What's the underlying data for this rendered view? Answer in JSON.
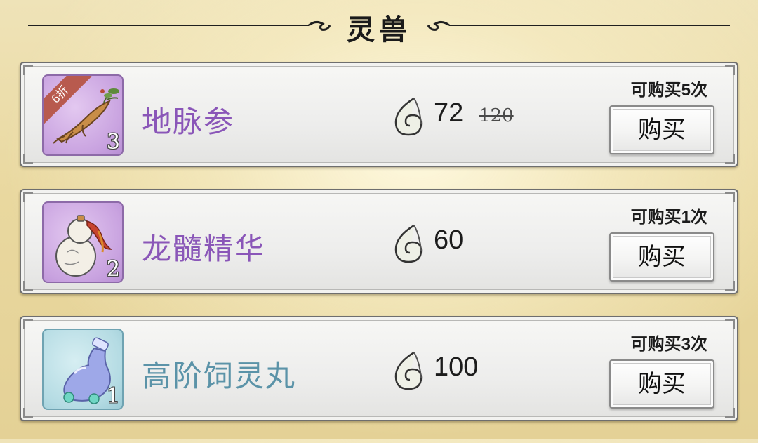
{
  "header": {
    "title": "灵兽"
  },
  "currency": {
    "icon": "spirit-jade-icon"
  },
  "items": [
    {
      "name": "地脉参",
      "name_color": "#8a56b8",
      "icon": "ginseng-icon",
      "rarity_bg": "purple",
      "quantity": "3",
      "discount_badge": "6折",
      "price": "72",
      "original_price": "120",
      "purchase_limit": "可购买5次",
      "buy_label": "购买"
    },
    {
      "name": "龙髓精华",
      "name_color": "#8a56b8",
      "icon": "gourd-icon",
      "rarity_bg": "purple",
      "quantity": "2",
      "price": "60",
      "purchase_limit": "可购买1次",
      "buy_label": "购买"
    },
    {
      "name": "高阶饲灵丸",
      "name_color": "#5b93a8",
      "icon": "elixir-bottle-icon",
      "rarity_bg": "blue",
      "quantity": "1",
      "price": "100",
      "purchase_limit": "可购买3次",
      "buy_label": "购买"
    }
  ]
}
